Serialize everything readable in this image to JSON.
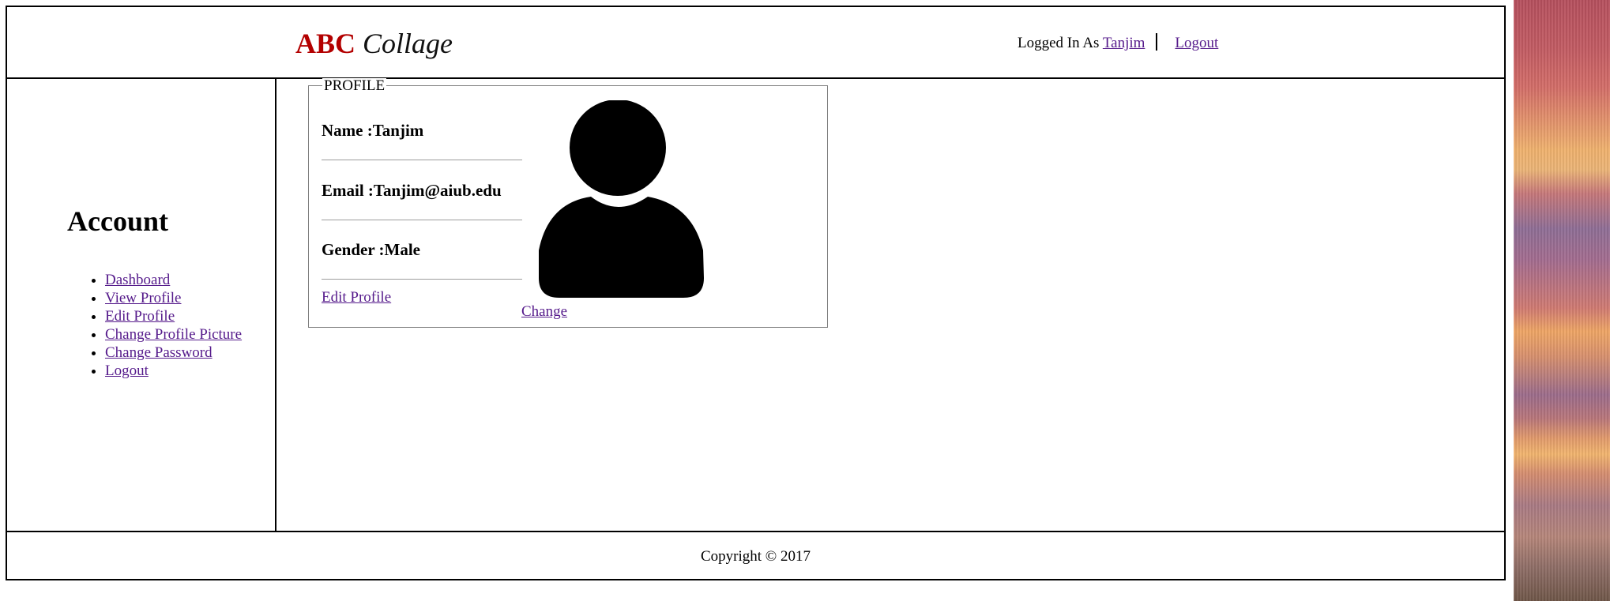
{
  "header": {
    "logo_abc": "ABC",
    "logo_collage": "Collage",
    "logged_in_as": "Logged In As",
    "username": "Tanjim",
    "logout": "Logout"
  },
  "sidebar": {
    "title": "Account",
    "items": [
      {
        "label": "Dashboard"
      },
      {
        "label": "View Profile"
      },
      {
        "label": "Edit Profile"
      },
      {
        "label": "Change Profile Picture"
      },
      {
        "label": "Change Password"
      },
      {
        "label": "Logout"
      }
    ]
  },
  "profile": {
    "legend": "PROFILE",
    "name": "Name :Tanjim",
    "email": "Email :Tanjim@aiub.edu",
    "gender": "Gender :Male",
    "edit_link": "Edit Profile",
    "change_link": "Change",
    "avatar_icon": "user-silhouette-icon"
  },
  "footer": {
    "copyright": "Copyright © 2017"
  },
  "colors": {
    "logo_accent": "#b30000",
    "link": "#551a8b",
    "border": "#000000"
  }
}
